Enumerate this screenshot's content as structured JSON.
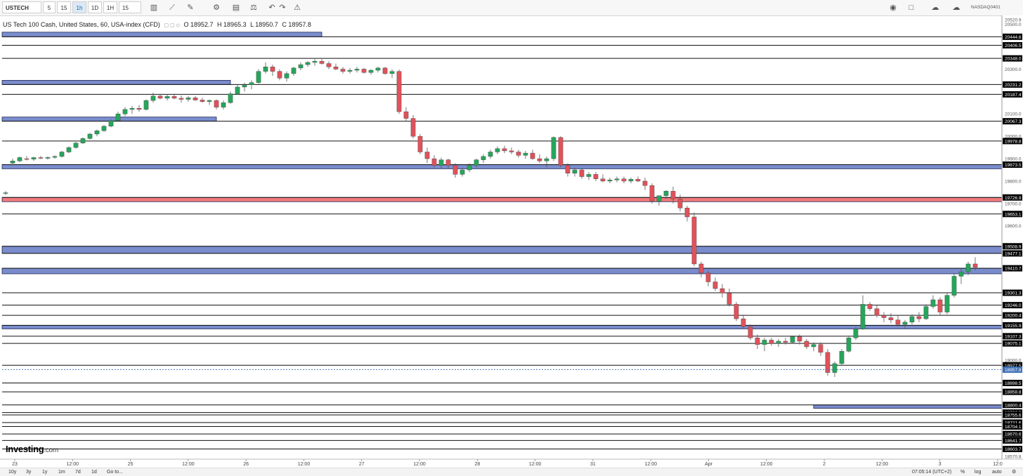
{
  "toolbar": {
    "symbol": "USTECH",
    "intervals": [
      "5",
      "15",
      "1h",
      "1D",
      "1H",
      "15"
    ],
    "active_interval": "1h",
    "right_label": "NASDAQ0401"
  },
  "legend": {
    "title": "US Tech 100 Cash, United States, 60, USA-index (CFD)",
    "open": "O 18952.7",
    "high": "H 18965.3",
    "low": "L 18950.7",
    "close": "C 18957.8"
  },
  "logo": {
    "main": "Investing",
    "suffix": ".com"
  },
  "bottom": {
    "ranges": [
      "10y",
      "3y",
      "1y",
      "1m",
      "7d",
      "1d",
      "Go to..."
    ],
    "clock": "07:05:14 (UTC+2)",
    "right": [
      "%",
      "log",
      "auto"
    ]
  },
  "colors": {
    "bull": "#26a65b",
    "bear": "#e0525a",
    "zone_blue": "#6b7fc6",
    "zone_red": "#ef6b6b",
    "price_line": "#3d6fb6"
  },
  "chart_data": {
    "type": "candlestick",
    "symbol": "USTECH",
    "timeframe": "60",
    "ylim": [
      18570.8,
      20520.9
    ],
    "price_axis_labels": [
      "20520.9",
      "20500.0",
      "20444.6",
      "20406.5",
      "20348.0",
      "20300.0",
      "20231.2",
      "20187.4",
      "20100.0",
      "20067.3",
      "20000.0",
      "19978.8",
      "19900.0",
      "19873.5",
      "19800.0",
      "19726.9",
      "19700.0",
      "19653.1",
      "19600.0",
      "19508.9",
      "19477.1",
      "19410.7",
      "19301.3",
      "19246.0",
      "19200.4",
      "19155.9",
      "19107.3",
      "19075.1",
      "19000.0",
      "18977.5",
      "18957.8",
      "18898.5",
      "18858.8",
      "18800.4",
      "18766.3",
      "18755.6",
      "18721.6",
      "18704.1",
      "18670.6",
      "18641.7",
      "18603.7",
      "18570.8"
    ],
    "horizontal_levels": [
      20444.6,
      20406.5,
      20348.0,
      20231.2,
      20187.4,
      20067.3,
      19978.8,
      19873.5,
      19726.9,
      19653.1,
      19508.9,
      19477.1,
      19410.7,
      19301.3,
      19246.0,
      19200.4,
      19155.9,
      19107.3,
      19075.1,
      18977.5,
      18898.5,
      18858.8,
      18800.4,
      18766.3,
      18755.6,
      18721.6,
      18704.1,
      18670.6,
      18641.7,
      18603.7
    ],
    "current_price": 18957.8,
    "x_tick_labels": [
      "23",
      "12:00",
      "25",
      "12:00",
      "26",
      "12:00",
      "27",
      "12:00",
      "28",
      "12:00",
      "31",
      "12:00",
      "Apr",
      "12:00",
      "2",
      "12:00",
      "3",
      "12:0"
    ],
    "zones": [
      {
        "color": "blue",
        "x_end_index": 45,
        "low": 20444.6,
        "high": 20465.0
      },
      {
        "color": "blue",
        "x_end_index": 32,
        "low": 20231.2,
        "high": 20250.0
      },
      {
        "color": "blue",
        "x_end_index": 30,
        "low": 20067.3,
        "high": 20086.0
      },
      {
        "color": "blue",
        "x_end_index": 143,
        "low": 19855.0,
        "high": 19873.5
      },
      {
        "color": "red",
        "x_end_index": 143,
        "low": 19708.0,
        "high": 19726.9
      },
      {
        "color": "blue",
        "x_end_index": 143,
        "low": 19477.1,
        "high": 19508.9
      },
      {
        "color": "blue",
        "x_end_index": 143,
        "low": 19386.0,
        "high": 19410.7
      },
      {
        "color": "blue",
        "x_end_index": 143,
        "low": 19140.0,
        "high": 19155.9
      },
      {
        "color": "blue",
        "x_start_index": 115,
        "x_end_index": 143,
        "low": 18785.0,
        "high": 18800.4
      }
    ],
    "candles": [
      [
        19745,
        19755,
        19738,
        19748
      ],
      [
        19880,
        19900,
        19870,
        19890
      ],
      [
        19890,
        19910,
        19885,
        19905
      ],
      [
        19900,
        19912,
        19892,
        19898
      ],
      [
        19898,
        19908,
        19890,
        19905
      ],
      [
        19905,
        19912,
        19898,
        19902
      ],
      [
        19902,
        19910,
        19896,
        19906
      ],
      [
        19906,
        19915,
        19900,
        19910
      ],
      [
        19910,
        19935,
        19905,
        19930
      ],
      [
        19930,
        19955,
        19925,
        19950
      ],
      [
        19950,
        19975,
        19945,
        19970
      ],
      [
        19970,
        19995,
        19965,
        19990
      ],
      [
        19990,
        20015,
        19985,
        20010
      ],
      [
        20010,
        20030,
        20000,
        20025
      ],
      [
        20025,
        20050,
        20020,
        20045
      ],
      [
        20045,
        20075,
        20040,
        20070
      ],
      [
        20070,
        20110,
        20065,
        20100
      ],
      [
        20100,
        20130,
        20090,
        20120
      ],
      [
        20120,
        20135,
        20100,
        20125
      ],
      [
        20125,
        20140,
        20110,
        20120
      ],
      [
        20120,
        20165,
        20115,
        20160
      ],
      [
        20160,
        20195,
        20150,
        20180
      ],
      [
        20180,
        20190,
        20165,
        20170
      ],
      [
        20170,
        20185,
        20160,
        20178
      ],
      [
        20178,
        20190,
        20165,
        20170
      ],
      [
        20170,
        20182,
        20150,
        20165
      ],
      [
        20165,
        20180,
        20155,
        20172
      ],
      [
        20172,
        20180,
        20158,
        20162
      ],
      [
        20162,
        20172,
        20150,
        20155
      ],
      [
        20155,
        20165,
        20140,
        20160
      ],
      [
        20160,
        20165,
        20120,
        20130
      ],
      [
        20130,
        20160,
        20120,
        20150
      ],
      [
        20150,
        20200,
        20145,
        20190
      ],
      [
        20190,
        20230,
        20185,
        20220
      ],
      [
        20220,
        20240,
        20200,
        20230
      ],
      [
        20230,
        20250,
        20210,
        20240
      ],
      [
        20240,
        20300,
        20235,
        20290
      ],
      [
        20290,
        20330,
        20280,
        20310
      ],
      [
        20310,
        20320,
        20270,
        20290
      ],
      [
        20290,
        20300,
        20250,
        20260
      ],
      [
        20260,
        20290,
        20245,
        20280
      ],
      [
        20280,
        20310,
        20270,
        20305
      ],
      [
        20305,
        20330,
        20295,
        20320
      ],
      [
        20320,
        20335,
        20310,
        20330
      ],
      [
        20330,
        20345,
        20315,
        20335
      ],
      [
        20335,
        20345,
        20320,
        20325
      ],
      [
        20325,
        20335,
        20300,
        20310
      ],
      [
        20310,
        20325,
        20295,
        20300
      ],
      [
        20300,
        20310,
        20280,
        20290
      ],
      [
        20290,
        20305,
        20280,
        20295
      ],
      [
        20295,
        20310,
        20285,
        20300
      ],
      [
        20300,
        20305,
        20280,
        20285
      ],
      [
        20285,
        20300,
        20275,
        20295
      ],
      [
        20295,
        20310,
        20285,
        20305
      ],
      [
        20305,
        20310,
        20275,
        20280
      ],
      [
        20280,
        20300,
        20260,
        20290
      ],
      [
        20290,
        20298,
        20100,
        20110
      ],
      [
        20110,
        20130,
        20070,
        20080
      ],
      [
        20080,
        20095,
        19990,
        20000
      ],
      [
        20000,
        20010,
        19920,
        19930
      ],
      [
        19930,
        19950,
        19880,
        19900
      ],
      [
        19900,
        19915,
        19860,
        19870
      ],
      [
        19870,
        19905,
        19855,
        19895
      ],
      [
        19895,
        19900,
        19855,
        19870
      ],
      [
        19870,
        19880,
        19815,
        19830
      ],
      [
        19830,
        19860,
        19820,
        19850
      ],
      [
        19850,
        19880,
        19840,
        19870
      ],
      [
        19870,
        19900,
        19860,
        19895
      ],
      [
        19895,
        19920,
        19880,
        19910
      ],
      [
        19910,
        19940,
        19900,
        19930
      ],
      [
        19930,
        19955,
        19920,
        19945
      ],
      [
        19945,
        19958,
        19925,
        19935
      ],
      [
        19935,
        19950,
        19920,
        19930
      ],
      [
        19930,
        19940,
        19905,
        19915
      ],
      [
        19915,
        19935,
        19900,
        19925
      ],
      [
        19925,
        19940,
        19895,
        19900
      ],
      [
        19900,
        19920,
        19880,
        19890
      ],
      [
        19890,
        19910,
        19860,
        19900
      ],
      [
        19900,
        20000,
        19890,
        19995
      ],
      [
        19995,
        20000,
        19860,
        19870
      ],
      [
        19870,
        19880,
        19820,
        19835
      ],
      [
        19835,
        19860,
        19820,
        19850
      ],
      [
        19850,
        19860,
        19810,
        19820
      ],
      [
        19820,
        19840,
        19805,
        19830
      ],
      [
        19830,
        19840,
        19800,
        19810
      ],
      [
        19810,
        19830,
        19795,
        19800
      ],
      [
        19800,
        19815,
        19790,
        19805
      ],
      [
        19805,
        19820,
        19795,
        19810
      ],
      [
        19810,
        19820,
        19790,
        19800
      ],
      [
        19800,
        19815,
        19790,
        19808
      ],
      [
        19808,
        19820,
        19795,
        19800
      ],
      [
        19800,
        19815,
        19760,
        19780
      ],
      [
        19780,
        19790,
        19700,
        19710
      ],
      [
        19710,
        19730,
        19690,
        19735
      ],
      [
        19735,
        19760,
        19720,
        19755
      ],
      [
        19755,
        19775,
        19700,
        19720
      ],
      [
        19720,
        19740,
        19665,
        19680
      ],
      [
        19680,
        19690,
        19620,
        19640
      ],
      [
        19640,
        19660,
        19420,
        19430
      ],
      [
        19430,
        19440,
        19370,
        19390
      ],
      [
        19390,
        19400,
        19330,
        19350
      ],
      [
        19350,
        19370,
        19310,
        19320
      ],
      [
        19320,
        19340,
        19280,
        19300
      ],
      [
        19300,
        19320,
        19240,
        19250
      ],
      [
        19250,
        19260,
        19175,
        19185
      ],
      [
        19185,
        19200,
        19140,
        19150
      ],
      [
        19150,
        19160,
        19090,
        19100
      ],
      [
        19100,
        19115,
        19050,
        19070
      ],
      [
        19070,
        19100,
        19040,
        19090
      ],
      [
        19090,
        19100,
        19065,
        19075
      ],
      [
        19075,
        19095,
        19060,
        19085
      ],
      [
        19085,
        19100,
        19070,
        19080
      ],
      [
        19080,
        19110,
        19075,
        19105
      ],
      [
        19105,
        19115,
        19070,
        19085
      ],
      [
        19085,
        19095,
        19050,
        19060
      ],
      [
        19060,
        19080,
        19040,
        19070
      ],
      [
        19070,
        19080,
        19020,
        19035
      ],
      [
        19035,
        19050,
        18930,
        18945
      ],
      [
        18945,
        18995,
        18925,
        18985
      ],
      [
        18985,
        19050,
        18975,
        19040
      ],
      [
        19040,
        19105,
        19035,
        19100
      ],
      [
        19100,
        19150,
        19090,
        19140
      ],
      [
        19140,
        19290,
        19135,
        19250
      ],
      [
        19250,
        19260,
        19220,
        19230
      ],
      [
        19230,
        19245,
        19190,
        19200
      ],
      [
        19200,
        19215,
        19170,
        19190
      ],
      [
        19190,
        19210,
        19165,
        19180
      ],
      [
        19180,
        19200,
        19150,
        19160
      ],
      [
        19160,
        19180,
        19140,
        19170
      ],
      [
        19170,
        19205,
        19160,
        19195
      ],
      [
        19195,
        19215,
        19170,
        19185
      ],
      [
        19185,
        19250,
        19180,
        19240
      ],
      [
        19240,
        19290,
        19230,
        19270
      ],
      [
        19270,
        19280,
        19200,
        19215
      ],
      [
        19215,
        19300,
        19205,
        19290
      ],
      [
        19290,
        19390,
        19280,
        19375
      ],
      [
        19375,
        19410,
        19340,
        19395
      ],
      [
        19395,
        19440,
        19380,
        19430
      ],
      [
        19430,
        19460,
        19400,
        19415
      ]
    ]
  }
}
